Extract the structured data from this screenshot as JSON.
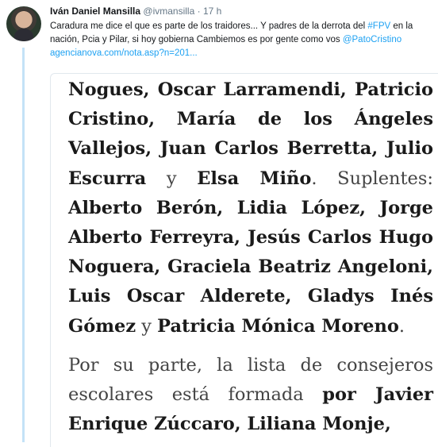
{
  "tweet": {
    "display_name": "Iván Daniel Mansilla",
    "handle": "@ivmansilla",
    "separator": "·",
    "time": "17 h",
    "text_part1": "Caradura me dice el que es parte de los traidores... Y padres de la derrota del ",
    "hashtag": "#FPV",
    "text_part2": " en la nación, Pcia y Pilar, si hoy gobierna Cambiemos es por gente como vos ",
    "mention": "@PatoCristino",
    "link": "agencianova.com/nota.asp?n=201..."
  },
  "article": {
    "p1": [
      {
        "t": "Nogues, Oscar Larramendi, Patricio Cristino, María de los Ángeles Vallejos, Juan Carlos Berretta, Julio Escurra",
        "b": true
      },
      {
        "t": " y ",
        "b": false
      },
      {
        "t": "Elsa Miño",
        "b": true
      },
      {
        "t": ". Suplentes: ",
        "b": false
      },
      {
        "t": "Alberto Berón, Lidia López, Jorge Alberto Ferreyra, Jesús Carlos Hugo Noguera, Graciela Beatriz Angeloni, Luis Oscar Alderete, Gladys Inés Gómez",
        "b": true
      },
      {
        "t": " y ",
        "b": false
      },
      {
        "t": "Patricia Mónica Moreno",
        "b": true
      },
      {
        "t": ".",
        "b": false
      }
    ],
    "p2": [
      {
        "t": "Por su parte, la lista de consejeros escolares está formada ",
        "b": false
      },
      {
        "t": "por Javier Enrique Zúccaro, Liliana Monje,",
        "b": true
      }
    ]
  }
}
